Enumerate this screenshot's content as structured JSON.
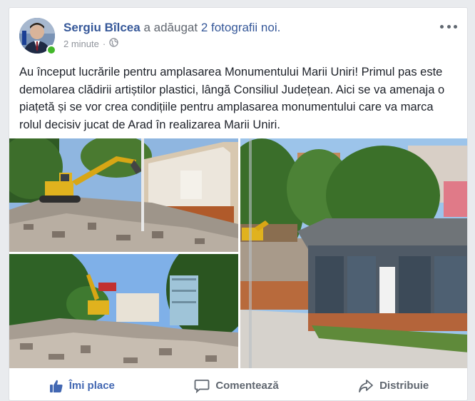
{
  "post": {
    "author": "Sergiu Bîlcea",
    "action_text": "a adăugat",
    "photos_text": "2 fotografii noi.",
    "timestamp": "2 minute",
    "separator": "·",
    "privacy_icon": "globe-icon",
    "more_icon": "more-options-icon",
    "text": "Au început lucrările pentru amplasarea Monumentului Marii Uniri! Primul pas este demolarea clădirii artiștilor plastici, lângă Consiliul Județean. Aici se va amenaja o piațetă și se vor crea condițiile pentru amplasarea monumentului care va marca rolul decisiv jucat de Arad în realizarea Marii Uniri."
  },
  "photos": [
    {
      "name": "demolition-excavator-photo"
    },
    {
      "name": "demolition-debris-photo"
    },
    {
      "name": "building-before-demolition-photo"
    }
  ],
  "actions": {
    "like": {
      "label": "Îmi place",
      "icon": "thumbs-up-icon",
      "active": true
    },
    "comment": {
      "label": "Comentează",
      "icon": "comment-icon"
    },
    "share": {
      "label": "Distribuie",
      "icon": "share-icon"
    }
  },
  "colors": {
    "link": "#365899",
    "like_active": "#4267b2",
    "online": "#42b72a",
    "muted": "#606770"
  }
}
